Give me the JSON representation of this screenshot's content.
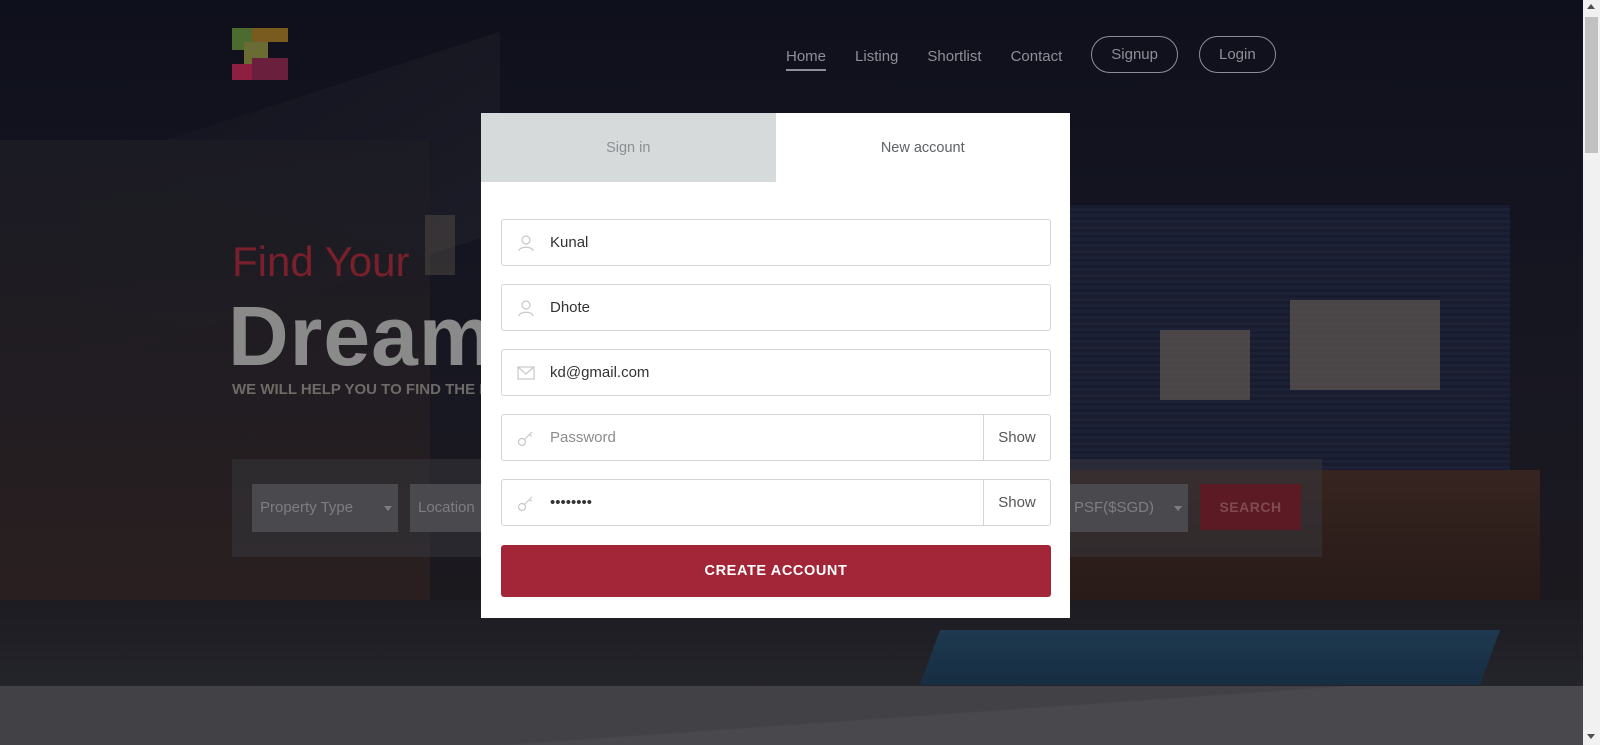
{
  "nav": {
    "home": "Home",
    "listing": "Listing",
    "shortlist": "Shortlist",
    "contact": "Contact",
    "signup": "Signup",
    "login": "Login"
  },
  "hero": {
    "find_your": "Find Your",
    "dream": "Dream",
    "subtitle": "WE WILL HELP YOU TO FIND THE BE"
  },
  "search": {
    "property_type": "Property Type",
    "location": "Location",
    "psf": "PSF($SGD)",
    "button": "SEARCH"
  },
  "modal": {
    "tab_signin": "Sign in",
    "tab_new_account": "New account",
    "fields": {
      "first_name": {
        "value": "Kunal",
        "icon": "user-icon"
      },
      "last_name": {
        "value": "Dhote",
        "icon": "user-icon"
      },
      "email": {
        "value": "kd@gmail.com",
        "icon": "mail-icon"
      },
      "password": {
        "value": "",
        "placeholder": "Password",
        "icon": "key-icon"
      },
      "confirm_password": {
        "value": "........",
        "icon": "key-icon"
      }
    },
    "show_label": "Show",
    "create_button": "CREATE ACCOUNT"
  },
  "colors": {
    "accent": "#a32638",
    "tab_inactive_bg": "#d6dadb"
  }
}
